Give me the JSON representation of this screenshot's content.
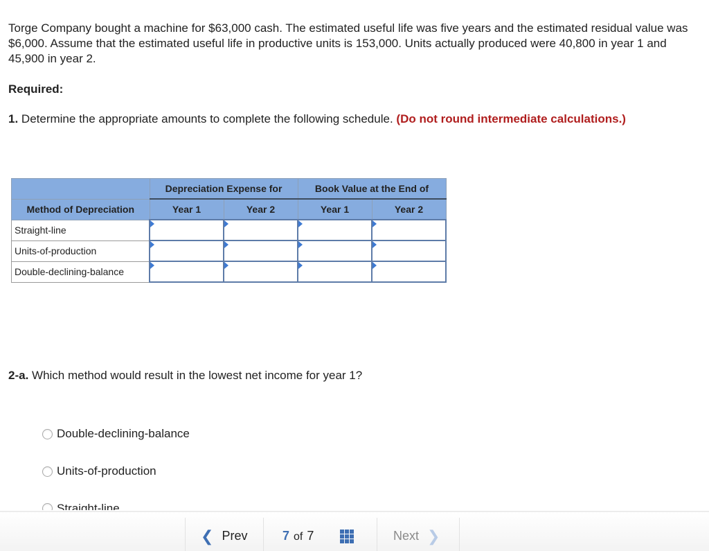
{
  "problem": {
    "text": "Torge Company bought a machine for $63,000 cash. The estimated useful life was five years and the estimated residual value was $6,000. Assume that the estimated useful life in productive units is 153,000. Units actually produced were 40,800 in year 1 and 45,900 in year 2."
  },
  "required_label": "Required:",
  "question1": {
    "number": "1.",
    "text": "Determine the appropriate amounts to complete the following schedule.",
    "note": "(Do not round intermediate calculations.)"
  },
  "schedule": {
    "group_headers": [
      "Depreciation Expense for",
      "Book Value at the End of"
    ],
    "method_header": "Method of Depreciation",
    "sub_headers": [
      "Year 1",
      "Year 2",
      "Year 1",
      "Year 2"
    ],
    "rows": [
      {
        "method": "Straight-line",
        "values": [
          "",
          "",
          "",
          ""
        ]
      },
      {
        "method": "Units-of-production",
        "values": [
          "",
          "",
          "",
          ""
        ]
      },
      {
        "method": "Double-declining-balance",
        "values": [
          "",
          "",
          "",
          ""
        ]
      }
    ]
  },
  "question2a": {
    "number": "2-a.",
    "text": "Which method would result in the lowest net income for year 1?",
    "options": [
      "Double-declining-balance",
      "Units-of-production",
      "Straight-line"
    ]
  },
  "footer": {
    "prev_label": "Prev",
    "current_page": "7",
    "of_label": "of",
    "total_pages": "7",
    "next_label": "Next"
  },
  "colors": {
    "accent": "#3e6fb3",
    "header_bg": "#86acdf",
    "note_red": "#b01e1e"
  }
}
